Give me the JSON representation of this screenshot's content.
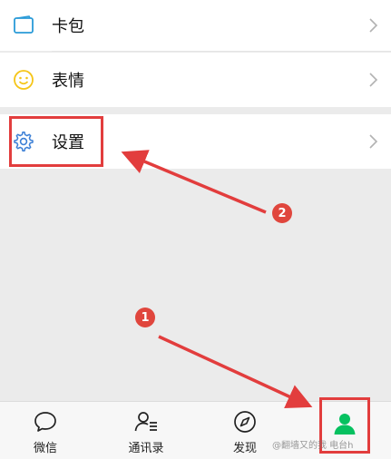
{
  "menu": {
    "card": {
      "label": "卡包",
      "icon": "card-wallet-icon"
    },
    "sticker": {
      "label": "表情",
      "icon": "smiley-icon"
    },
    "settings": {
      "label": "设置",
      "icon": "gear-icon"
    }
  },
  "tabbar": {
    "tabs": [
      {
        "label": "微信",
        "icon": "chat-bubble-icon"
      },
      {
        "label": "通讯录",
        "icon": "contacts-icon"
      },
      {
        "label": "发现",
        "icon": "compass-icon"
      },
      {
        "label": "",
        "icon": "me-person-icon",
        "active": true
      }
    ]
  },
  "annotations": {
    "step1": "1",
    "step2": "2"
  },
  "watermark": "@翻墙又的我 电台h",
  "colors": {
    "accent_green": "#07c160",
    "annotation_red": "#e23d3d",
    "card_icon_blue": "#2a9bd8",
    "smiley_yellow": "#f5c518",
    "gear_blue": "#3b7fd6"
  }
}
